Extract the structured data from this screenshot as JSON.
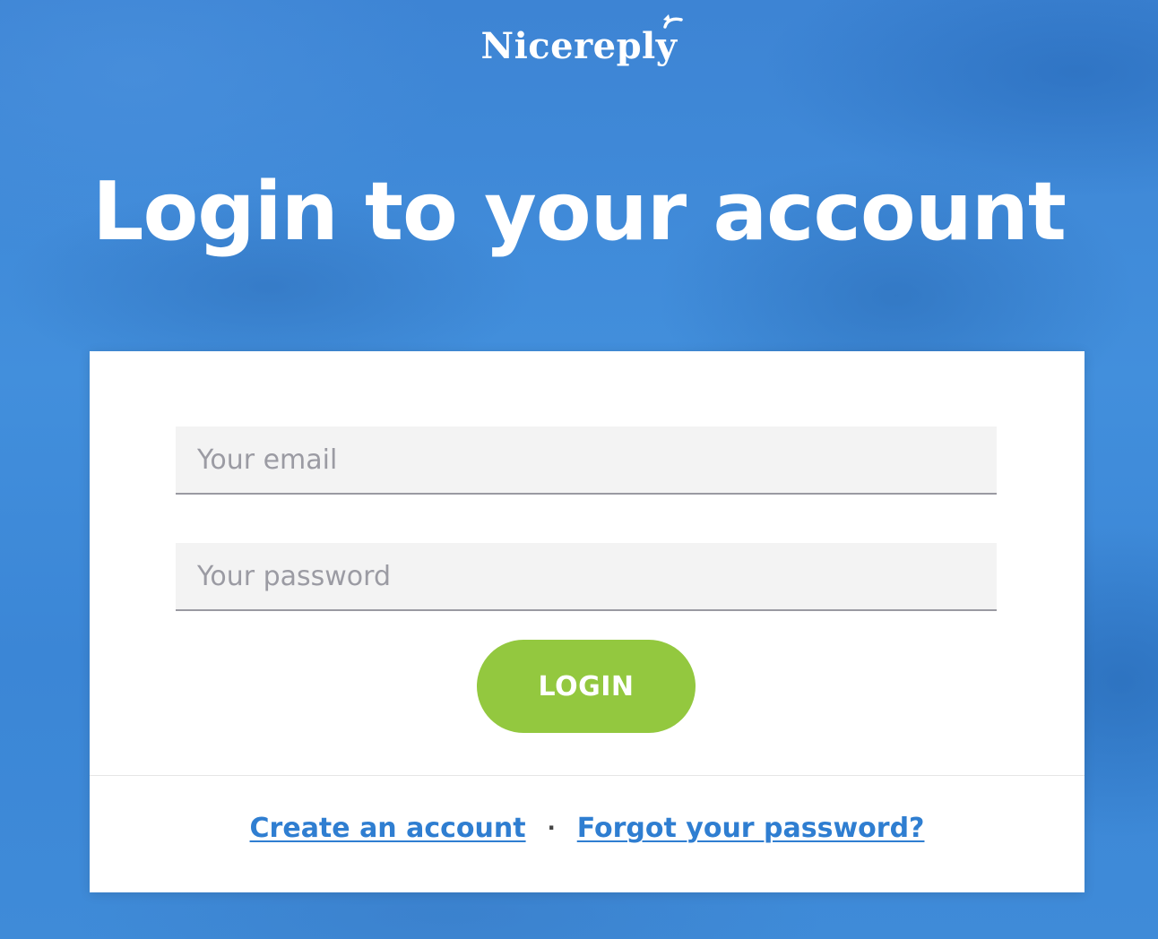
{
  "brand": {
    "logo_text": "Nicereply"
  },
  "page": {
    "title": "Login to your account"
  },
  "form": {
    "email_placeholder": "Your email",
    "password_placeholder": "Your password",
    "login_label": "LOGIN"
  },
  "footer": {
    "create_account_label": "Create an account",
    "separator": "·",
    "forgot_password_label": "Forgot your password?"
  },
  "colors": {
    "background": "#3f8ad8",
    "card": "#ffffff",
    "login_button": "#93c83f",
    "link": "#2f7ed1"
  }
}
